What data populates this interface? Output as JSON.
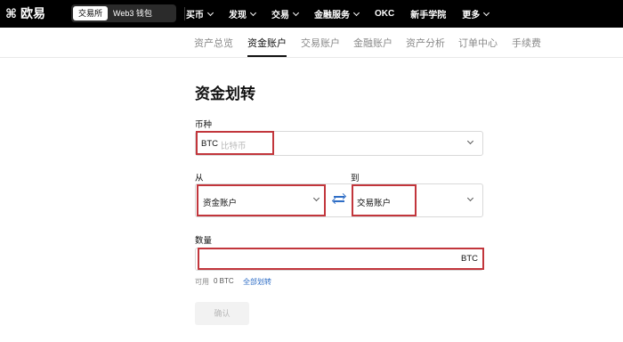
{
  "brand": {
    "logo_mark": "⌘",
    "name": "欧易"
  },
  "segment": {
    "options": [
      "交易所",
      "Web3 钱包"
    ],
    "active": "交易所"
  },
  "menu": [
    {
      "label": "买币",
      "dropdown": true
    },
    {
      "label": "发现",
      "dropdown": true
    },
    {
      "label": "交易",
      "dropdown": true
    },
    {
      "label": "金融服务",
      "dropdown": true
    },
    {
      "label": "OKC",
      "dropdown": false
    },
    {
      "label": "新手学院",
      "dropdown": false
    },
    {
      "label": "更多",
      "dropdown": true
    }
  ],
  "subtabs": [
    "资产总览",
    "资金账户",
    "交易账户",
    "金融账户",
    "资产分析",
    "订单中心",
    "手续费"
  ],
  "active_subtab": "资金账户",
  "form": {
    "title": "资金划转",
    "coin_label": "币种",
    "coin_value": "BTC",
    "coin_sub": "比特币",
    "from_label": "从",
    "from_value": "资金账户",
    "to_label": "到",
    "to_value": "交易账户",
    "amount_label": "数量",
    "amount_value": "",
    "amount_unit": "BTC",
    "available_label": "可用",
    "available_value": "0 BTC",
    "transfer_all": "全部划转",
    "confirm_label": "确认"
  },
  "colors": {
    "accent_link": "#2f6ec6",
    "highlight_border": "#c2363c",
    "nav_bg": "#000000"
  }
}
